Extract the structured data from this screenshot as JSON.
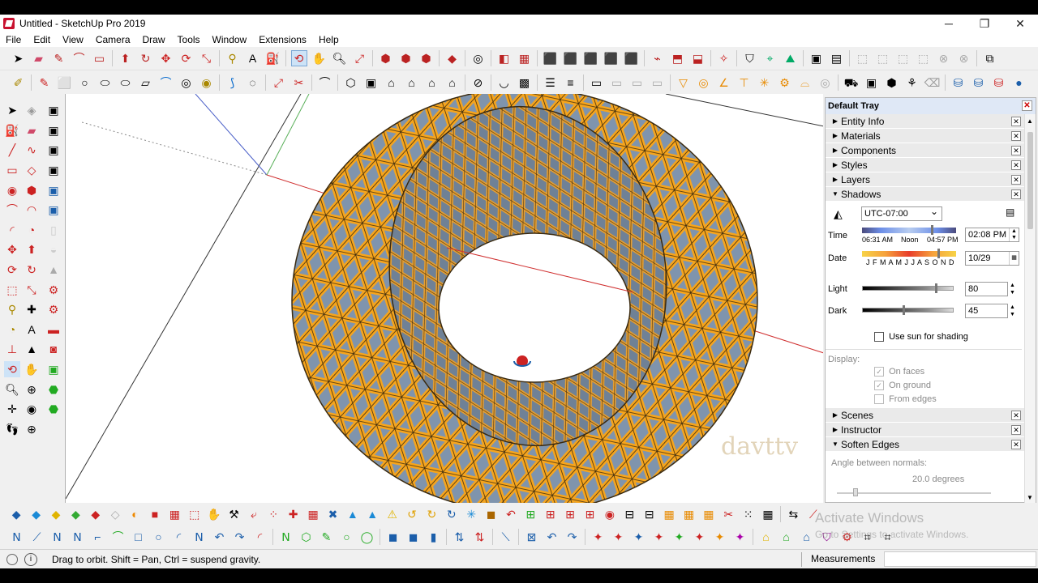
{
  "window": {
    "title": "Untitled - SketchUp Pro 2019",
    "minimize": "─",
    "maximize": "❐",
    "close": "✕"
  },
  "menu": [
    "File",
    "Edit",
    "View",
    "Camera",
    "Draw",
    "Tools",
    "Window",
    "Extensions",
    "Help"
  ],
  "tray": {
    "title": "Default Tray",
    "panels_top": [
      {
        "label": "Entity Info"
      },
      {
        "label": "Materials"
      },
      {
        "label": "Components"
      },
      {
        "label": "Styles"
      },
      {
        "label": "Layers"
      },
      {
        "label": "Shadows"
      }
    ],
    "panels_bottom": [
      {
        "label": "Scenes"
      },
      {
        "label": "Instructor"
      },
      {
        "label": "Soften Edges"
      }
    ],
    "shadows": {
      "timezone": "UTC-07:00",
      "time_label": "Time",
      "time_start": "06:31 AM",
      "time_noon": "Noon",
      "time_end": "04:57 PM",
      "time_value": "02:08 PM",
      "date_label": "Date",
      "months": "J F M A M J J A S O N D",
      "date_value": "10/29",
      "light_label": "Light",
      "light_value": "80",
      "dark_label": "Dark",
      "dark_value": "45",
      "use_sun_label": "Use sun for shading",
      "display_label": "Display:",
      "on_faces": "On faces",
      "on_ground": "On ground",
      "from_edges": "From edges"
    },
    "soften": {
      "angle_label": "Angle between normals:",
      "angle_value": "20.0  degrees"
    }
  },
  "status": {
    "info_icon": "i",
    "message": "Drag to orbit. Shift = Pan, Ctrl = suspend gravity.",
    "measurements_label": "Measurements"
  },
  "viewport_watermark": "davttv",
  "activate_windows": {
    "line1": "Activate Windows",
    "line2": "Go to Settings to activate Windows."
  },
  "colors": {
    "frame": "#f7a51c",
    "glass": "#7a8ea6",
    "accent": "#dfe8f6"
  }
}
